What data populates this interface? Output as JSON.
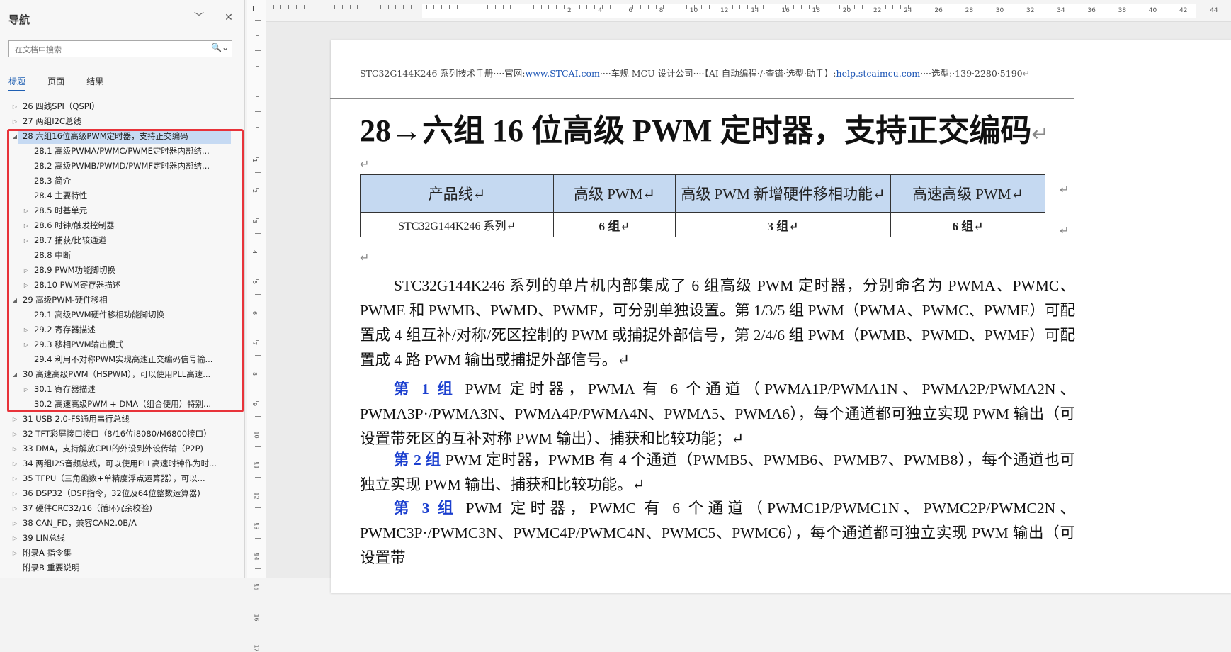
{
  "nav": {
    "title": "导航",
    "collapse_glyph": "﹀",
    "close_glyph": "✕",
    "search_placeholder": "在文档中搜索",
    "search_glyph": "🔍⌄",
    "tabs": [
      {
        "label": "标题",
        "active": true
      },
      {
        "label": "页面",
        "active": false
      },
      {
        "label": "结果",
        "active": false
      }
    ],
    "items": [
      {
        "level": 0,
        "expander": "▷",
        "label": "26 四线SPI（QSPI）"
      },
      {
        "level": 0,
        "expander": "▷",
        "label": "27 两组I2C总线"
      },
      {
        "level": 0,
        "expander": "◢",
        "label": "28 六组16位高级PWM定时器，支持正交编码",
        "selected": true
      },
      {
        "level": 1,
        "expander": "",
        "label": "28.1 高级PWMA/PWMC/PWME定时器内部结..."
      },
      {
        "level": 1,
        "expander": "",
        "label": "28.2 高级PWMB/PWMD/PWMF定时器内部结..."
      },
      {
        "level": 1,
        "expander": "",
        "label": "28.3 简介"
      },
      {
        "level": 1,
        "expander": "",
        "label": "28.4 主要特性"
      },
      {
        "level": 1,
        "expander": "▷",
        "label": "28.5 时基单元"
      },
      {
        "level": 1,
        "expander": "▷",
        "label": "28.6 时钟/触发控制器"
      },
      {
        "level": 1,
        "expander": "▷",
        "label": "28.7 捕获/比较通道"
      },
      {
        "level": 1,
        "expander": "",
        "label": "28.8 中断"
      },
      {
        "level": 1,
        "expander": "▷",
        "label": "28.9 PWM功能脚切换"
      },
      {
        "level": 1,
        "expander": "▷",
        "label": "28.10 PWM寄存器描述"
      },
      {
        "level": 0,
        "expander": "◢",
        "label": "29 高级PWM-硬件移相"
      },
      {
        "level": 1,
        "expander": "",
        "label": "29.1 高级PWM硬件移相功能脚切换"
      },
      {
        "level": 1,
        "expander": "▷",
        "label": "29.2 寄存器描述"
      },
      {
        "level": 1,
        "expander": "▷",
        "label": "29.3 移相PWM输出模式"
      },
      {
        "level": 1,
        "expander": "",
        "label": "29.4 利用不对称PWM实现高速正交编码信号输..."
      },
      {
        "level": 0,
        "expander": "◢",
        "label": "30 高速高级PWM（HSPWM），可以使用PLL高速..."
      },
      {
        "level": 1,
        "expander": "▷",
        "label": "30.1 寄存器描述"
      },
      {
        "level": 1,
        "expander": "",
        "label": "30.2 高速高级PWM + DMA（组合使用）特别..."
      },
      {
        "level": 0,
        "expander": "▷",
        "label": "31 USB 2.0-FS通用串行总线"
      },
      {
        "level": 0,
        "expander": "▷",
        "label": "32 TFT彩屏接口接口（8/16位i8080/M6800接口）"
      },
      {
        "level": 0,
        "expander": "▷",
        "label": "33 DMA，支持解放CPU的外设到外设传输（P2P)"
      },
      {
        "level": 0,
        "expander": "▷",
        "label": "34 两组I2S音频总线，可以使用PLL高速时钟作为时..."
      },
      {
        "level": 0,
        "expander": "▷",
        "label": "35 TFPU（三角函数+单精度浮点运算器），可以..."
      },
      {
        "level": 0,
        "expander": "▷",
        "label": "36 DSP32（DSP指令，32位及64位整数运算器)"
      },
      {
        "level": 0,
        "expander": "▷",
        "label": "37 硬件CRC32/16（循环冗余校验)"
      },
      {
        "level": 0,
        "expander": "▷",
        "label": "38 CAN_FD，兼容CAN2.0B/A"
      },
      {
        "level": 0,
        "expander": "▷",
        "label": "39 LIN总线"
      },
      {
        "level": 0,
        "expander": "▷",
        "label": "附录A 指令集"
      },
      {
        "level": 0,
        "expander": "",
        "label": "附录B 重要说明"
      }
    ]
  },
  "ruler": {
    "h_numbers": [
      "2",
      "4",
      "6",
      "8",
      "10",
      "12",
      "14",
      "16",
      "18",
      "20",
      "22",
      "24",
      "26",
      "28",
      "30",
      "32",
      "34",
      "36",
      "38",
      "40",
      "42",
      "44"
    ],
    "v_numbers": [
      "1",
      "2",
      "3",
      "4",
      "5",
      "6",
      "7",
      "8",
      "9",
      "10",
      "11",
      "12",
      "13",
      "14",
      "15",
      "16",
      "17"
    ],
    "tab_marker": "L"
  },
  "doc": {
    "header": {
      "p1": "STC32G144K246 系列技术手册····官网:",
      "link1": "www.STCAI.com",
      "p2": "····车规 MCU 设计公司····【AI 自动编程·/·查错·选型·助手】:",
      "link2": "help.stcaimcu.com",
      "p3": "····选型:·139·2280·5190",
      "mark": "↵"
    },
    "title": "28→六组 16 位高级 PWM 定时器，支持正交编码",
    "return_mark": "↵",
    "table": {
      "headers": [
        "产品线↵",
        "高级 PWM↵",
        "高级 PWM 新增硬件移相功能↵",
        "高速高级 PWM↵"
      ],
      "row": [
        "STC32G144K246 系列↵",
        "6 组↵",
        "3 组↵",
        "6 组↵"
      ]
    },
    "intro": "STC32G144K246 系列的单片机内部集成了 6 组高级 PWM 定时器，分别命名为 PWMA、PWMC、PWME 和 PWMB、PWMD、PWMF，可分别单独设置。第 1/3/5 组 PWM（PWMA、PWMC、PWME）可配置成 4 组互补/对称/死区控制的 PWM 或捕捉外部信号，第 2/4/6 组 PWM（PWMB、PWMD、PWMF）可配置成 4 路 PWM 输出或捕捉外部信号。↵",
    "group1_label": "第 1 组",
    "group1_text": " PWM 定时器，PWMA 有 6 个通道（PWMA1P/PWMA1N、PWMA2P/PWMA2N、PWMA3P·/PWMA3N、PWMA4P/PWMA4N、PWMA5、PWMA6），每个通道都可独立实现 PWM 输出（可设置带死区的互补对称 PWM 输出）、捕获和比较功能；↵",
    "group2_label": "第 2 组",
    "group2_text": " PWM 定时器，PWMB 有 4 个通道（PWMB5、PWMB6、PWMB7、PWMB8），每个通道也可独立实现 PWM 输出、捕获和比较功能。↵",
    "group3_label": "第 3 组",
    "group3_text": " PWM 定时器，PWMC 有 6 个通道（PWMC1P/PWMC1N、PWMC2P/PWMC2N、PWMC3P·/PWMC3N、PWMC4P/PWMC4N、PWMC5、PWMC6），每个通道都可独立实现 PWM 输出（可设置带"
  }
}
